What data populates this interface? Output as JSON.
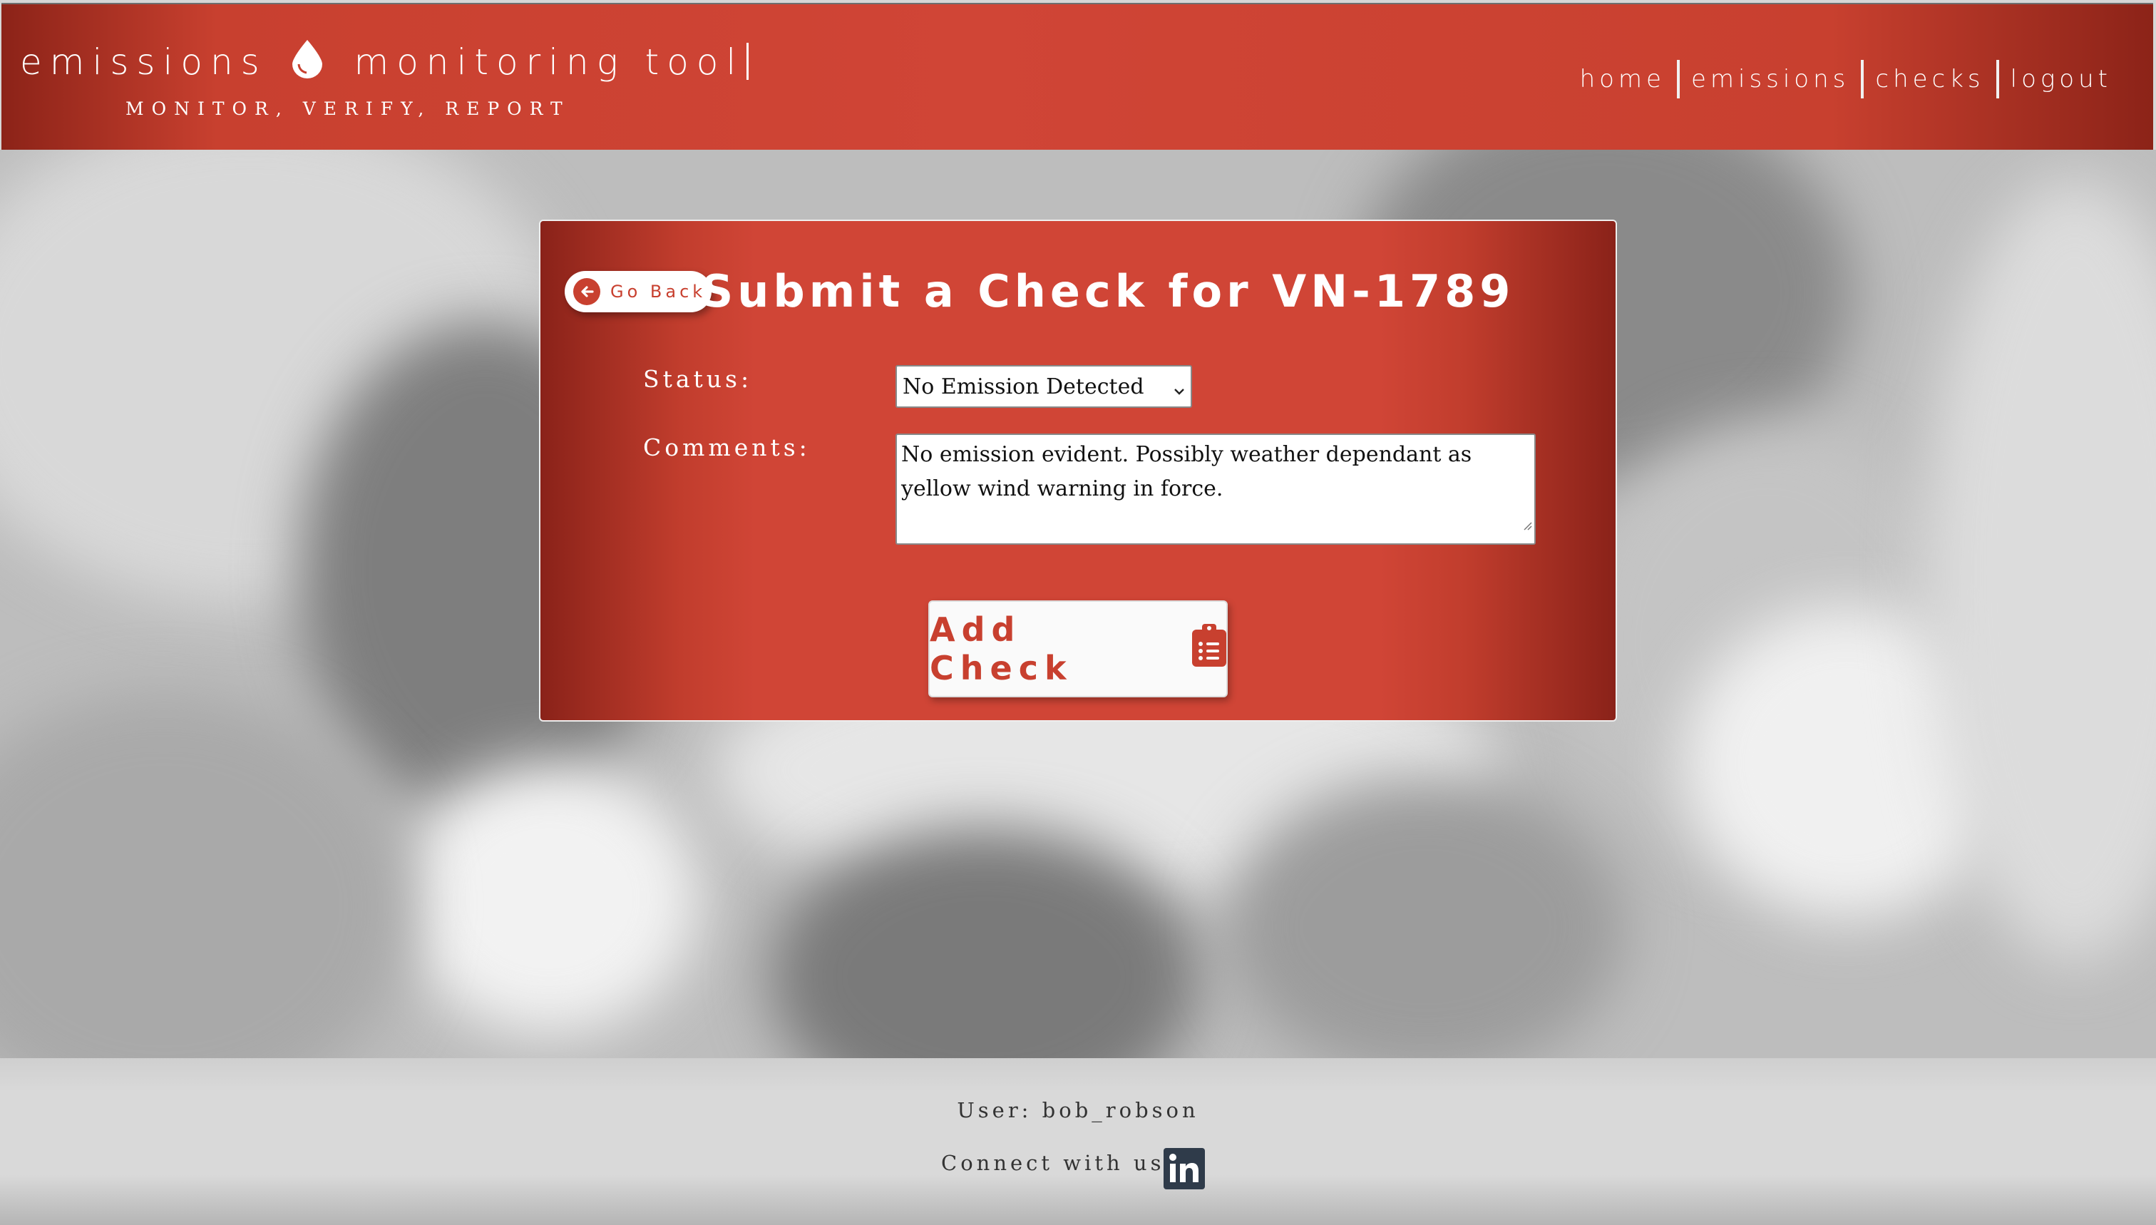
{
  "header": {
    "brand_left": "emissions",
    "brand_right": "monitoring tool",
    "tagline": "MONITOR, VERIFY, REPORT",
    "nav": [
      "home",
      "emissions",
      "checks",
      "logout"
    ]
  },
  "card": {
    "back_label": "Go Back",
    "title": "Submit a Check for VN-1789",
    "status_label": "Status:",
    "status_value": "No Emission Detected",
    "comments_label": "Comments:",
    "comments_value": "No emission evident. Possibly weather dependant as yellow wind warning in force.",
    "submit_label": "Add Check"
  },
  "footer": {
    "user": "User: bob_robson",
    "connect": "Connect with us:"
  },
  "icons": {
    "brand": "droplet-icon",
    "back": "arrow-left-circle-icon",
    "select": "chevron-down-icon",
    "submit": "clipboard-list-icon",
    "social": "linkedin-icon"
  },
  "colors": {
    "brand_red": "#d04536",
    "dark_red": "#8c2318",
    "footer": "#d9d9d9"
  }
}
